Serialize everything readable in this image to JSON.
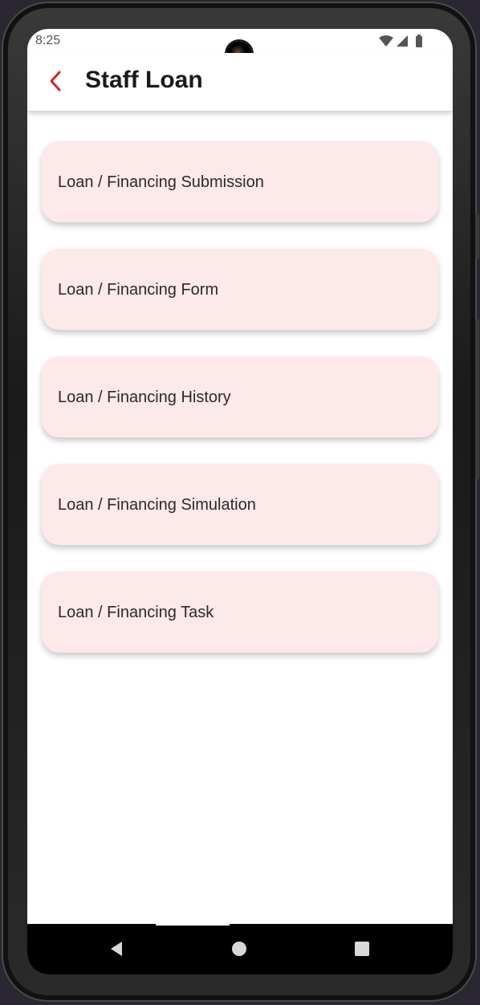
{
  "status_bar": {
    "time": "8:25",
    "icons": [
      "wifi-icon",
      "cellular-signal-icon",
      "battery-icon"
    ]
  },
  "app_bar": {
    "title": "Staff Loan",
    "back_icon": "chevron-left-icon",
    "accent_color": "#c62828"
  },
  "menu": {
    "items": [
      {
        "label": "Loan / Financing Submission"
      },
      {
        "label": "Loan / Financing Form"
      },
      {
        "label": "Loan / Financing History"
      },
      {
        "label": "Loan / Financing Simulation"
      },
      {
        "label": "Loan / Financing Task"
      }
    ],
    "item_background": "#fde8ea"
  },
  "nav_bar": {
    "buttons": [
      "back-triangle-icon",
      "home-circle-icon",
      "recents-square-icon"
    ]
  }
}
